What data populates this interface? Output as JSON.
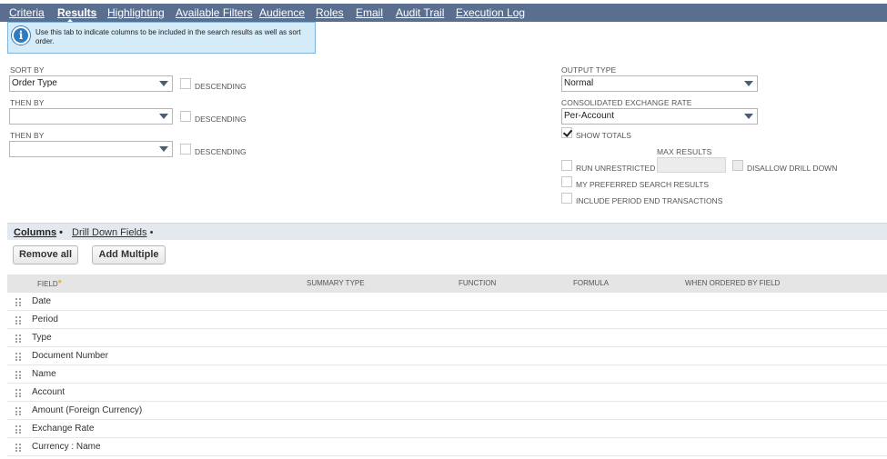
{
  "tabs": [
    {
      "label": "Criteria",
      "active": false
    },
    {
      "label": "Results",
      "active": true
    },
    {
      "label": "Highlighting",
      "active": false
    },
    {
      "label": "Available Filters",
      "active": false
    },
    {
      "label": "Audience",
      "active": false
    },
    {
      "label": "Roles",
      "active": false
    },
    {
      "label": "Email",
      "active": false
    },
    {
      "label": "Audit Trail",
      "active": false
    },
    {
      "label": "Execution Log",
      "active": false
    }
  ],
  "info": {
    "icon": "info-icon",
    "text": "Use this tab to indicate columns to be included in the search results as well as sort order."
  },
  "sort": {
    "sort_by_label": "SORT BY",
    "sort_by_value": "Order Type",
    "then_by_1_label": "THEN BY",
    "then_by_1_value": "",
    "then_by_2_label": "THEN BY",
    "then_by_2_value": "",
    "descending_label": "DESCENDING"
  },
  "output": {
    "output_type_label": "OUTPUT TYPE",
    "output_type_value": "Normal",
    "exchange_rate_label": "CONSOLIDATED EXCHANGE RATE",
    "exchange_rate_value": "Per-Account",
    "show_totals_label": "SHOW TOTALS",
    "show_totals_checked": true,
    "max_results_label": "MAX RESULTS",
    "max_results_value": "",
    "run_unrestricted_label": "RUN UNRESTRICTED",
    "disallow_drill_down_label": "DISALLOW DRILL DOWN",
    "my_preferred_label": "MY PREFERRED SEARCH RESULTS",
    "include_period_end_label": "INCLUDE PERIOD END TRANSACTIONS"
  },
  "subtabs": [
    {
      "label": "Columns",
      "suffix": "•",
      "active": true
    },
    {
      "label": "Drill Down Fields",
      "suffix": "•",
      "active": false
    }
  ],
  "buttons": {
    "remove_all": "Remove all",
    "add_multiple": "Add Multiple"
  },
  "columns_table": {
    "headers": {
      "field": "FIELD",
      "required_mark": "*",
      "summary_type": "SUMMARY TYPE",
      "function": "FUNCTION",
      "formula": "FORMULA",
      "when_ordered_by_field": "WHEN ORDERED BY FIELD"
    },
    "rows": [
      "Date",
      "Period",
      "Type",
      "Document Number",
      "Name",
      "Account",
      "Amount (Foreign Currency)",
      "Exchange Rate",
      "Currency : Name"
    ]
  },
  "colors": {
    "tabbar": "#5a6f8f",
    "info_bg": "#d5ebf7",
    "info_icon": "#2e7bbf",
    "subtabbar": "#e4e9f0",
    "table_header": "#e5e5e5",
    "required_mark": "#e69500"
  }
}
